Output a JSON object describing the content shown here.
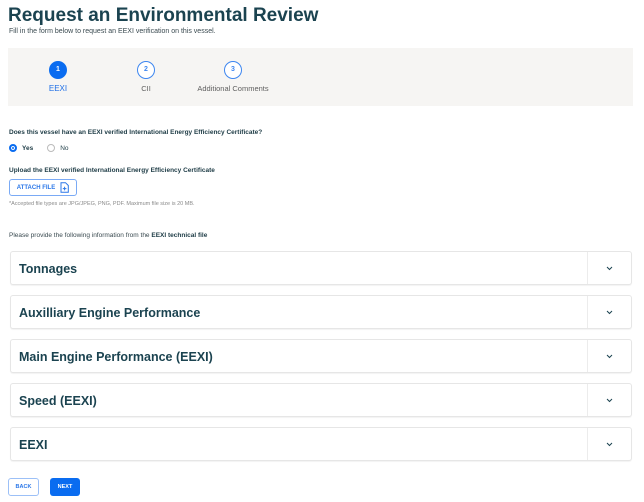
{
  "header": {
    "title": "Request an Environmental Review",
    "subtitle": "Fill in the form below to request an EEXI verification on this vessel."
  },
  "steps": [
    {
      "number": "1",
      "label": "EEXI",
      "active": true
    },
    {
      "number": "2",
      "label": "CII",
      "active": false
    },
    {
      "number": "3",
      "label": "Additional Comments",
      "active": false
    }
  ],
  "question": {
    "label": "Does this vessel have an EEXI verified International Energy Efficiency Certificate?",
    "options": [
      "Yes",
      "No"
    ],
    "selected": "Yes"
  },
  "upload": {
    "label": "Upload the EEXI verified International Energy Efficiency Certificate",
    "button": "ATTACH FILE",
    "note": "*Accepted file types are JPG/JPEG, PNG, PDF. Maximum file size is 20 MB."
  },
  "provide": {
    "text": "Please provide the following information from the ",
    "bold": "EEXI technical file"
  },
  "sections": [
    "Tonnages",
    "Auxilliary Engine Performance",
    "Main Engine Performance (EEXI)",
    "Speed (EEXI)",
    "EEXI"
  ],
  "footer": {
    "back": "BACK",
    "next": "NEXT"
  },
  "colors": {
    "primary": "#0a6cf0",
    "heading": "#1b4350"
  }
}
